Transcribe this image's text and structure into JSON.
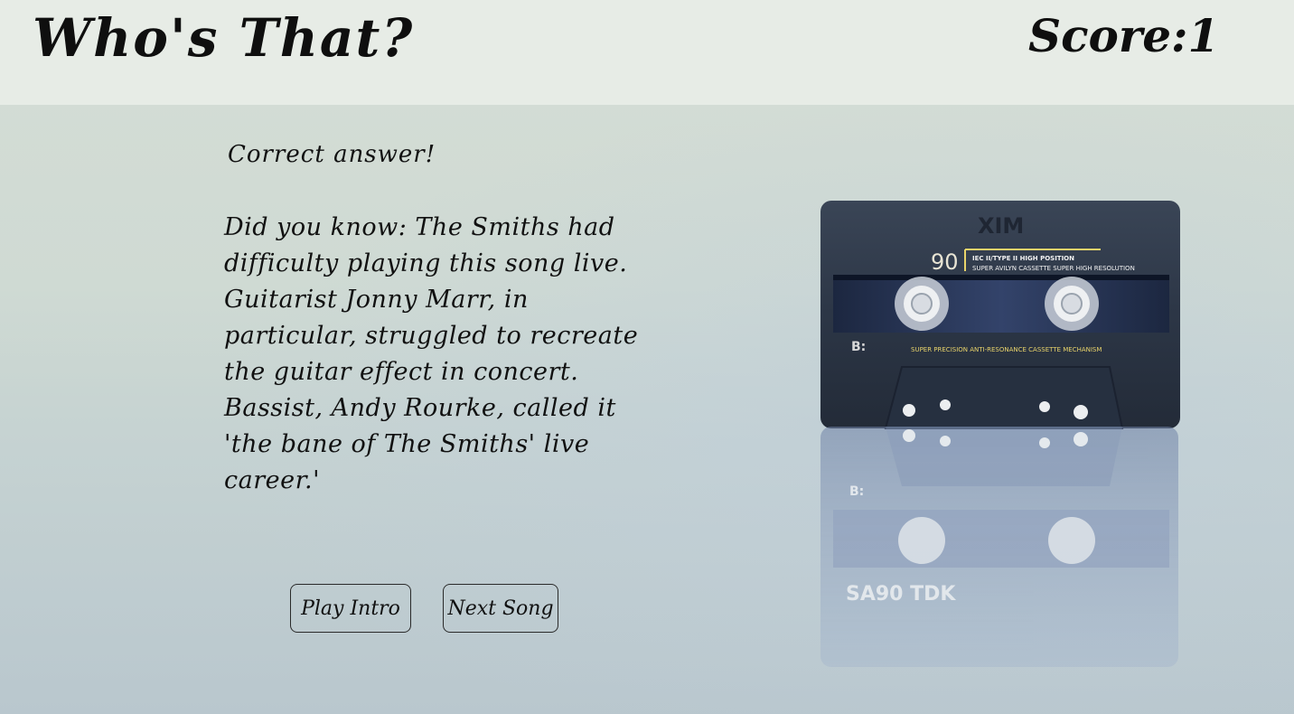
{
  "header": {
    "title": "Who's That?",
    "score": "Score:1"
  },
  "main": {
    "result_text": "Correct answer!",
    "fact_text": "Did you know: The Smiths had difficulty playing this song live. Guitarist Jonny Marr, in particular, struggled to recreate the guitar effect in concert. Bassist, Andy Rourke, called it 'the bane of The Smiths' live career.'"
  },
  "buttons": {
    "play_intro": "Play Intro",
    "next_song": "Next Song"
  },
  "cassette": {
    "brand": "XIM",
    "length": "90",
    "type_line1": "IEC II/TYPE II HIGH POSITION",
    "type_line2": "SUPER AVILYN CASSETTE SUPER HIGH RESOLUTION",
    "side": "B:",
    "mechanism": "SUPER PRECISION ANTI-RESONANCE CASSETTE MECHANISM",
    "reflection_text": "SA90 TDK"
  },
  "colors": {
    "background": "#cfdad3",
    "topbar": "#e7ece6",
    "cassette_body": "#2f3a4c"
  }
}
